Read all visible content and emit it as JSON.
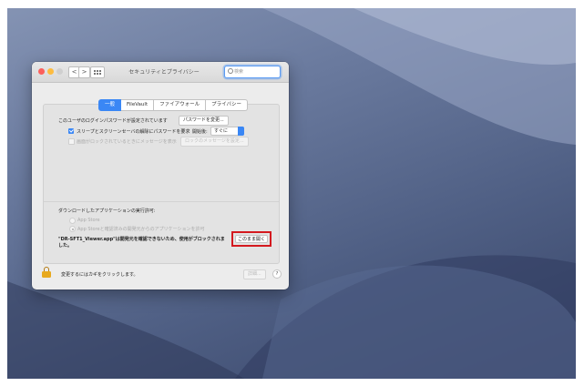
{
  "window": {
    "title": "セキュリティとプライバシー",
    "search_placeholder": "検索",
    "nav_back": "<",
    "nav_forward": ">"
  },
  "tabs": [
    {
      "label": "一般",
      "active": true
    },
    {
      "label": "FileVault",
      "active": false
    },
    {
      "label": "ファイアウォール",
      "active": false
    },
    {
      "label": "プライバシー",
      "active": false
    }
  ],
  "general": {
    "password_text": "このユーザのログインパスワードが設定されています",
    "change_password_button": "パスワードを変更...",
    "require_password_label": "スリープとスクリーンセーバの解除にパスワードを要求",
    "require_password_checked": true,
    "start_after_label": "開始後:",
    "start_after_value": "すぐに",
    "lock_message_label": "画面がロックされているときにメッセージを表示",
    "lock_message_checked": false,
    "lock_message_button": "ロックのメッセージを設定..."
  },
  "downloads": {
    "heading": "ダウンロードしたアプリケーションの実行許可:",
    "options": [
      {
        "label": "App Store",
        "selected": false
      },
      {
        "label": "App Storeと確認済みの開発元からのアプリケーションを許可",
        "selected": true
      }
    ],
    "blocked_message_line1": "\"DR-SFT1_Viewer.app\"は開発元を確認できないため、使用がブロックされま",
    "blocked_message_line2": "した。",
    "open_anyway_button": "このまま開く",
    "highlight_color": "#d4191f"
  },
  "footer": {
    "lock_text": "変更するにはカギをクリックします。",
    "advanced_button": "詳細...",
    "help_button": "?"
  },
  "colors": {
    "accent": "#3a87f5"
  }
}
